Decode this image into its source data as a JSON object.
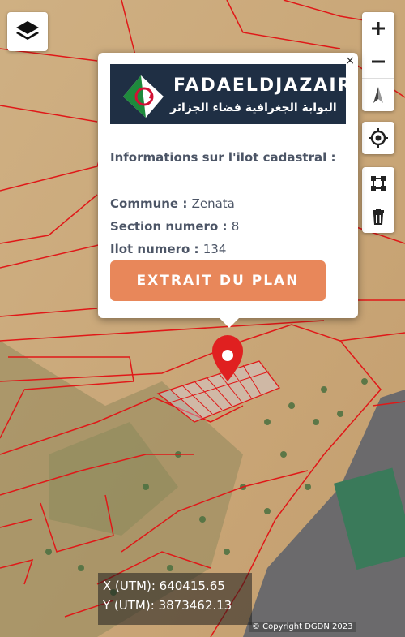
{
  "popup": {
    "logo_title": "FADAELDJAZAIR",
    "logo_arabic": "البوابة الجغرافية فضاء الجزائر",
    "heading": "Informations sur l'ilot cadastral :",
    "fields": [
      {
        "label": "Commune",
        "value": "Zenata"
      },
      {
        "label": "Section numero",
        "value": "8"
      },
      {
        "label": "Ilot numero",
        "value": "134"
      }
    ],
    "button_label": "EXTRAIT DU PLAN",
    "close_label": "×"
  },
  "coordinates": {
    "x_label": "X (UTM):",
    "x_value": "640415.65",
    "y_label": "Y (UTM):",
    "y_value": "3873462.13"
  },
  "attribution": "© Copyright DGDN 2023",
  "colors": {
    "accent_button": "#e8875a",
    "parcel_lines": "#e01818",
    "marker": "#e02020",
    "logo_bg": "#1f2f44"
  },
  "controls": {
    "layers": "layers-icon",
    "zoom_in": "plus-icon",
    "zoom_out": "minus-icon",
    "north": "compass-icon",
    "locate": "target-icon",
    "draw": "square-draw-icon",
    "delete": "trash-icon"
  }
}
